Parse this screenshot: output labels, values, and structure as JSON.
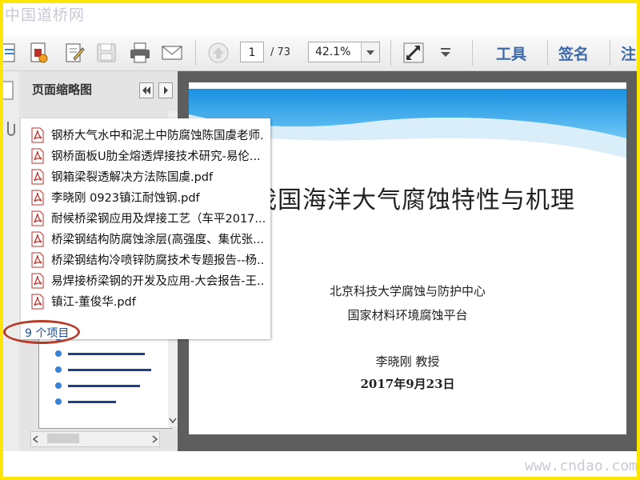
{
  "watermark": {
    "top": "中国道桥网",
    "bottom": "www.cndao.com"
  },
  "toolbar": {
    "page_current": "1",
    "page_total": "/ 73",
    "zoom": "42.1%",
    "tools_label": "工具",
    "sign_label": "签名",
    "comment_label": "注"
  },
  "panel": {
    "title": "页面缩略图"
  },
  "document": {
    "title": "我国海洋大气腐蚀特性与机理",
    "org1": "北京科技大学腐蚀与防护中心",
    "org2": "国家材料环境腐蚀平台",
    "author": "李晓刚 教授",
    "date": "2017年9月23日"
  },
  "popup": {
    "files": [
      "钢桥大气水中和泥土中防腐蚀陈国虞老师.",
      "钢桥面板U肋全熔透焊接技术研究-易伦...",
      "钢箱梁裂透解决方法陈国虞.pdf",
      "李晓刚 0923镇江耐蚀钢.pdf",
      "耐候桥梁钢应用及焊接工艺（车平2017...",
      "桥梁钢结构防腐蚀涂层(高强度、集优张...",
      "桥梁钢结构冷喷锌防腐技术专题报告--杨..",
      "易焊接桥梁钢的开发及应用-大会报告-王..",
      "镇江-董俊华.pdf"
    ],
    "count": "9 个项目"
  },
  "colors": {
    "accent": "#3e6aa8",
    "frame": "#ffe600",
    "highlight": "#b43c28",
    "pdf_red": "#c0302a"
  }
}
